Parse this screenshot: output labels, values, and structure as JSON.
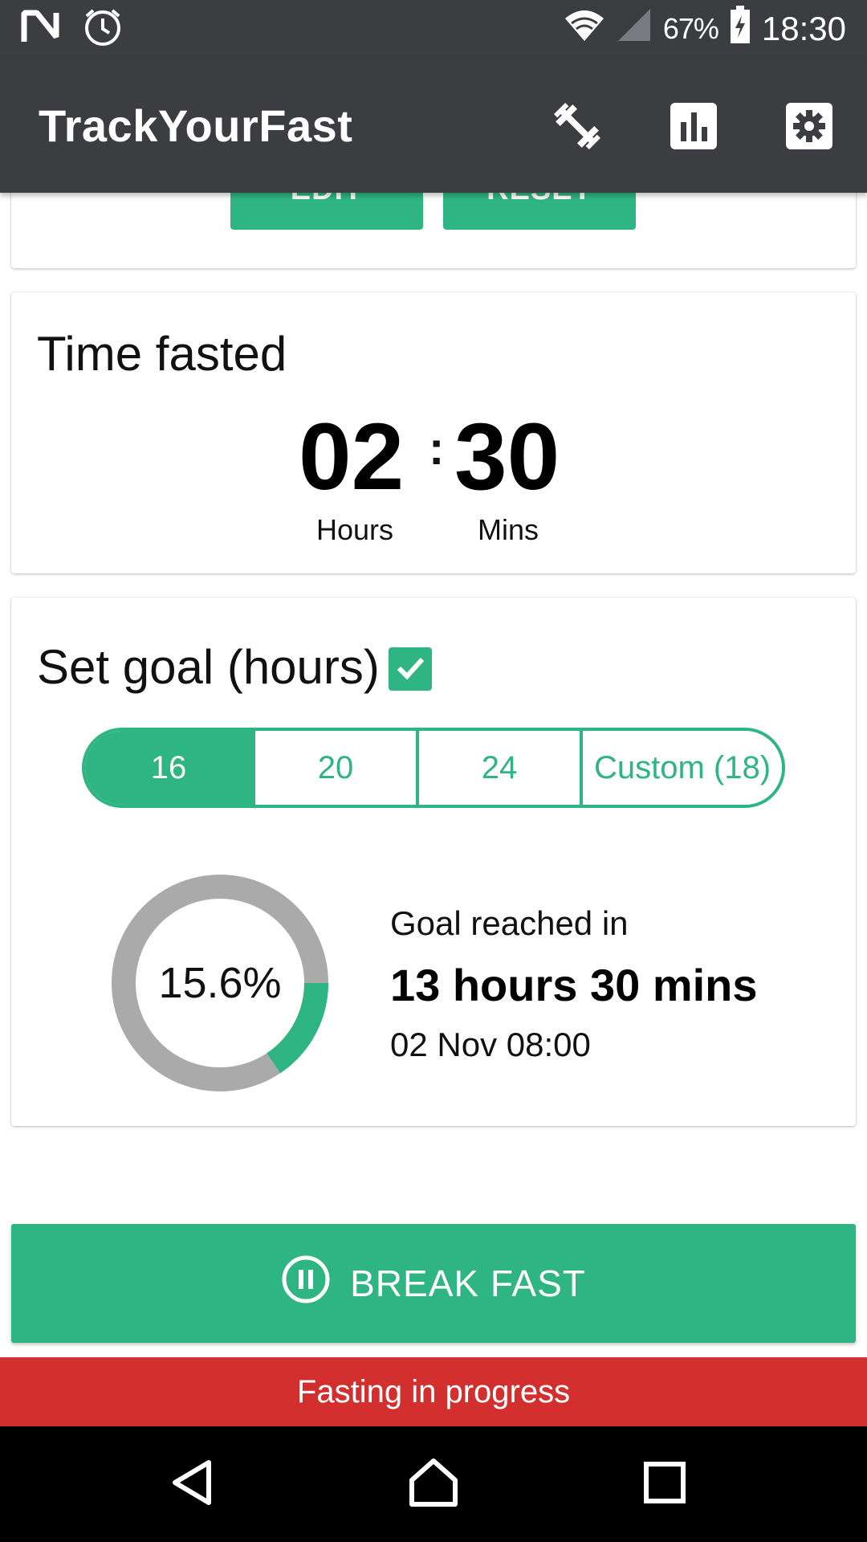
{
  "status_bar": {
    "battery": "67%",
    "time": "18:30",
    "icons": [
      "n-logo-icon",
      "alarm-icon",
      "wifi-icon",
      "signal-icon",
      "battery-charging-icon"
    ]
  },
  "app_bar": {
    "title": "TrackYourFast",
    "actions": [
      "exercise-icon",
      "bar-chart-icon",
      "settings-icon"
    ]
  },
  "top_card": {
    "edit_label": "EDIT",
    "reset_label": "RESET"
  },
  "time_fasted": {
    "title": "Time fasted",
    "hours": "02",
    "separator": ":",
    "minutes": "30",
    "hours_label": "Hours",
    "minutes_label": "Mins"
  },
  "goal": {
    "title": "Set goal (hours)",
    "enabled": true,
    "options": [
      "16",
      "20",
      "24",
      "Custom (18)"
    ],
    "selected": "16",
    "progress": 0.156,
    "progress_label": "15.6%",
    "reached_label": "Goal reached in",
    "remaining": "13 hours 30 mins",
    "target_datetime": "02 Nov 08:00"
  },
  "break_button": {
    "label": "BREAK FAST",
    "icon": "pause-circle-icon"
  },
  "status_banner": {
    "text": "Fasting in progress"
  },
  "colors": {
    "accent": "#2fb583",
    "toolbar": "#3c3d41",
    "banner": "#d32f2f",
    "ring_track": "#aaaaaa"
  }
}
